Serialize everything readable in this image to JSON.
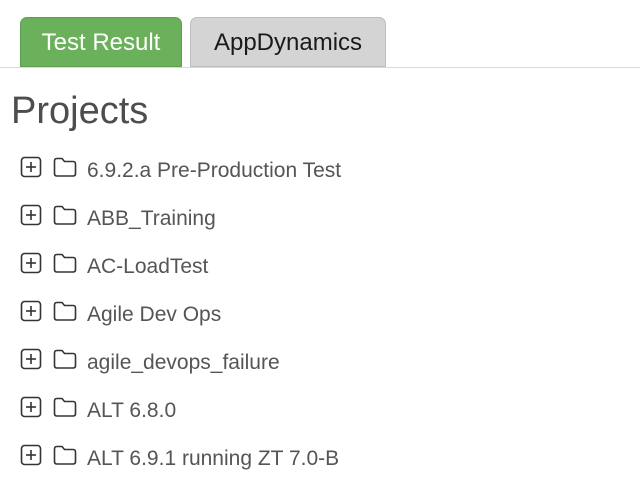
{
  "tabs": [
    {
      "label": "Test Result",
      "active": true
    },
    {
      "label": "AppDynamics",
      "active": false
    }
  ],
  "page": {
    "title": "Projects"
  },
  "projects": [
    {
      "name": "6.9.2.a Pre-Production Test",
      "icon": "folder-icon",
      "expand_icon": "plus-square-icon"
    },
    {
      "name": "ABB_Training",
      "icon": "folder-icon",
      "expand_icon": "plus-square-icon"
    },
    {
      "name": "AC-LoadTest",
      "icon": "folder-icon",
      "expand_icon": "plus-square-icon"
    },
    {
      "name": "Agile Dev Ops",
      "icon": "folder-icon",
      "expand_icon": "plus-square-icon"
    },
    {
      "name": "agile_devops_failure",
      "icon": "folder-icon",
      "expand_icon": "plus-square-icon"
    },
    {
      "name": "ALT 6.8.0",
      "icon": "folder-icon",
      "expand_icon": "plus-square-icon"
    },
    {
      "name": "ALT 6.9.1 running ZT 7.0-B",
      "icon": "folder-icon",
      "expand_icon": "plus-square-icon"
    }
  ],
  "colors": {
    "active_tab": "#6bb05a",
    "inactive_tab": "#d4d4d4",
    "title_text": "#4d4d4d",
    "item_text": "#555555"
  }
}
